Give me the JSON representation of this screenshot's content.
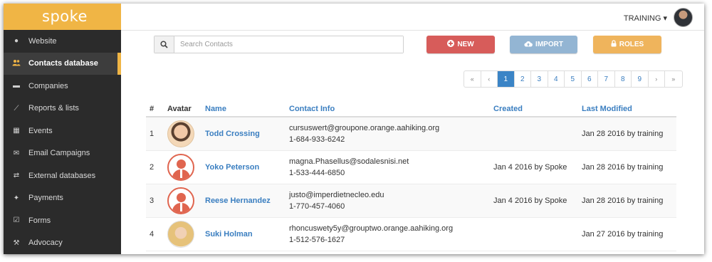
{
  "app": {
    "brand": "spoke"
  },
  "user": {
    "label": "TRAINING ▾"
  },
  "sidebar": {
    "items": [
      {
        "label": "Website",
        "icon": "globe-icon",
        "glyph": "●"
      },
      {
        "label": "Contacts database",
        "icon": "users-icon",
        "glyph": "👥"
      },
      {
        "label": "Companies",
        "icon": "briefcase-icon",
        "glyph": "▬"
      },
      {
        "label": "Reports & lists",
        "icon": "line-chart-icon",
        "glyph": "⟋"
      },
      {
        "label": "Events",
        "icon": "calendar-icon",
        "glyph": "▦"
      },
      {
        "label": "Email Campaigns",
        "icon": "envelope-icon",
        "glyph": "✉"
      },
      {
        "label": "External databases",
        "icon": "exchange-icon",
        "glyph": "⇄"
      },
      {
        "label": "Payments",
        "icon": "payment-icon",
        "glyph": "✦"
      },
      {
        "label": "Forms",
        "icon": "checkbox-icon",
        "glyph": "☑"
      },
      {
        "label": "Advocacy",
        "icon": "gavel-icon",
        "glyph": "⚒"
      }
    ]
  },
  "toolbar": {
    "search_placeholder": "Search Contacts",
    "new_label": "NEW",
    "import_label": "IMPORT",
    "roles_label": "ROLES"
  },
  "pagination": {
    "first": "«",
    "prev": "‹",
    "pages": [
      "1",
      "2",
      "3",
      "4",
      "5",
      "6",
      "7",
      "8",
      "9"
    ],
    "current": "1",
    "next": "›",
    "last": "»"
  },
  "table": {
    "headers": {
      "num": "#",
      "avatar": "Avatar",
      "name": "Name",
      "contact": "Contact Info",
      "created": "Created",
      "modified": "Last Modified"
    },
    "rows": [
      {
        "num": "1",
        "name": "Todd Crossing",
        "email": "cursuswert@groupone.orange.aahiking.org",
        "phone": "1-684-933-6242",
        "created": "",
        "modified": "Jan 28 2016 by training"
      },
      {
        "num": "2",
        "name": "Yoko Peterson",
        "email": "magna.Phasellus@sodalesnisi.net",
        "phone": "1-533-444-6850",
        "created": "Jan 4 2016 by Spoke",
        "modified": "Jan 28 2016 by training"
      },
      {
        "num": "3",
        "name": "Reese Hernandez",
        "email": "justo@imperdietnecleo.edu",
        "phone": "1-770-457-4060",
        "created": "Jan 4 2016 by Spoke",
        "modified": "Jan 28 2016 by training"
      },
      {
        "num": "4",
        "name": "Suki Holman",
        "email": "rhoncuswety5y@grouptwo.orange.aahiking.org",
        "phone": "1-512-576-1627",
        "created": "",
        "modified": "Jan 27 2016 by training"
      }
    ]
  }
}
